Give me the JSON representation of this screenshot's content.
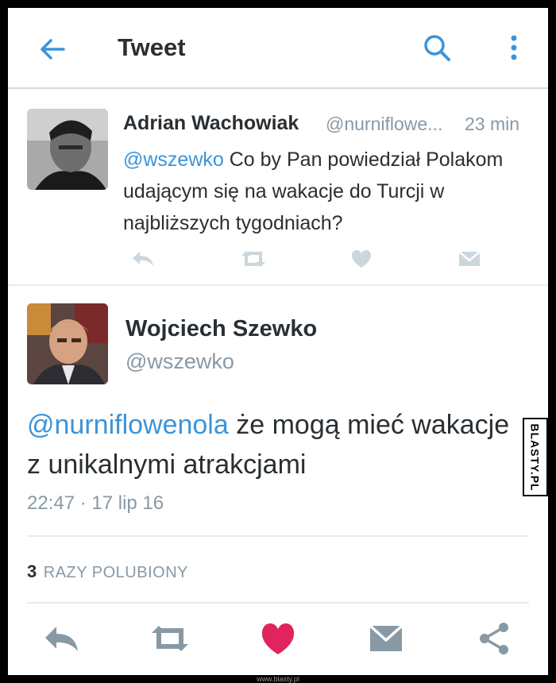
{
  "header": {
    "title": "Tweet"
  },
  "tweet1": {
    "author": "Adrian Wachowiak",
    "handle": "@nurniflowe...",
    "time": "23 min",
    "mention": "@wszewko",
    "text": " Co by Pan powiedział Polakom udającym się na wakacje do Turcji w najbliższych tygodniach?"
  },
  "tweet2": {
    "author": "Wojciech Szewko",
    "handle": "@wszewko",
    "mention": "@nurniflowenola",
    "text": " że mogą mieć wakacje z unikalnymi atrakcjami",
    "timestamp": "22:47 · 17 lip 16",
    "likes_count": "3",
    "likes_label": "RAZY POLUBIONY"
  },
  "colors": {
    "accent": "#3b94d9",
    "like": "#e0245e",
    "icon_gray": "#8899a6",
    "icon_light": "#ccd6dd"
  },
  "icons": [
    "back-arrow-icon",
    "search-icon",
    "more-vertical-icon",
    "reply-icon",
    "retweet-icon",
    "heart-icon",
    "dm-icon",
    "share-icon"
  ],
  "watermark": {
    "side": "BLASTY.PL",
    "footer": "www.blasty.pl"
  }
}
